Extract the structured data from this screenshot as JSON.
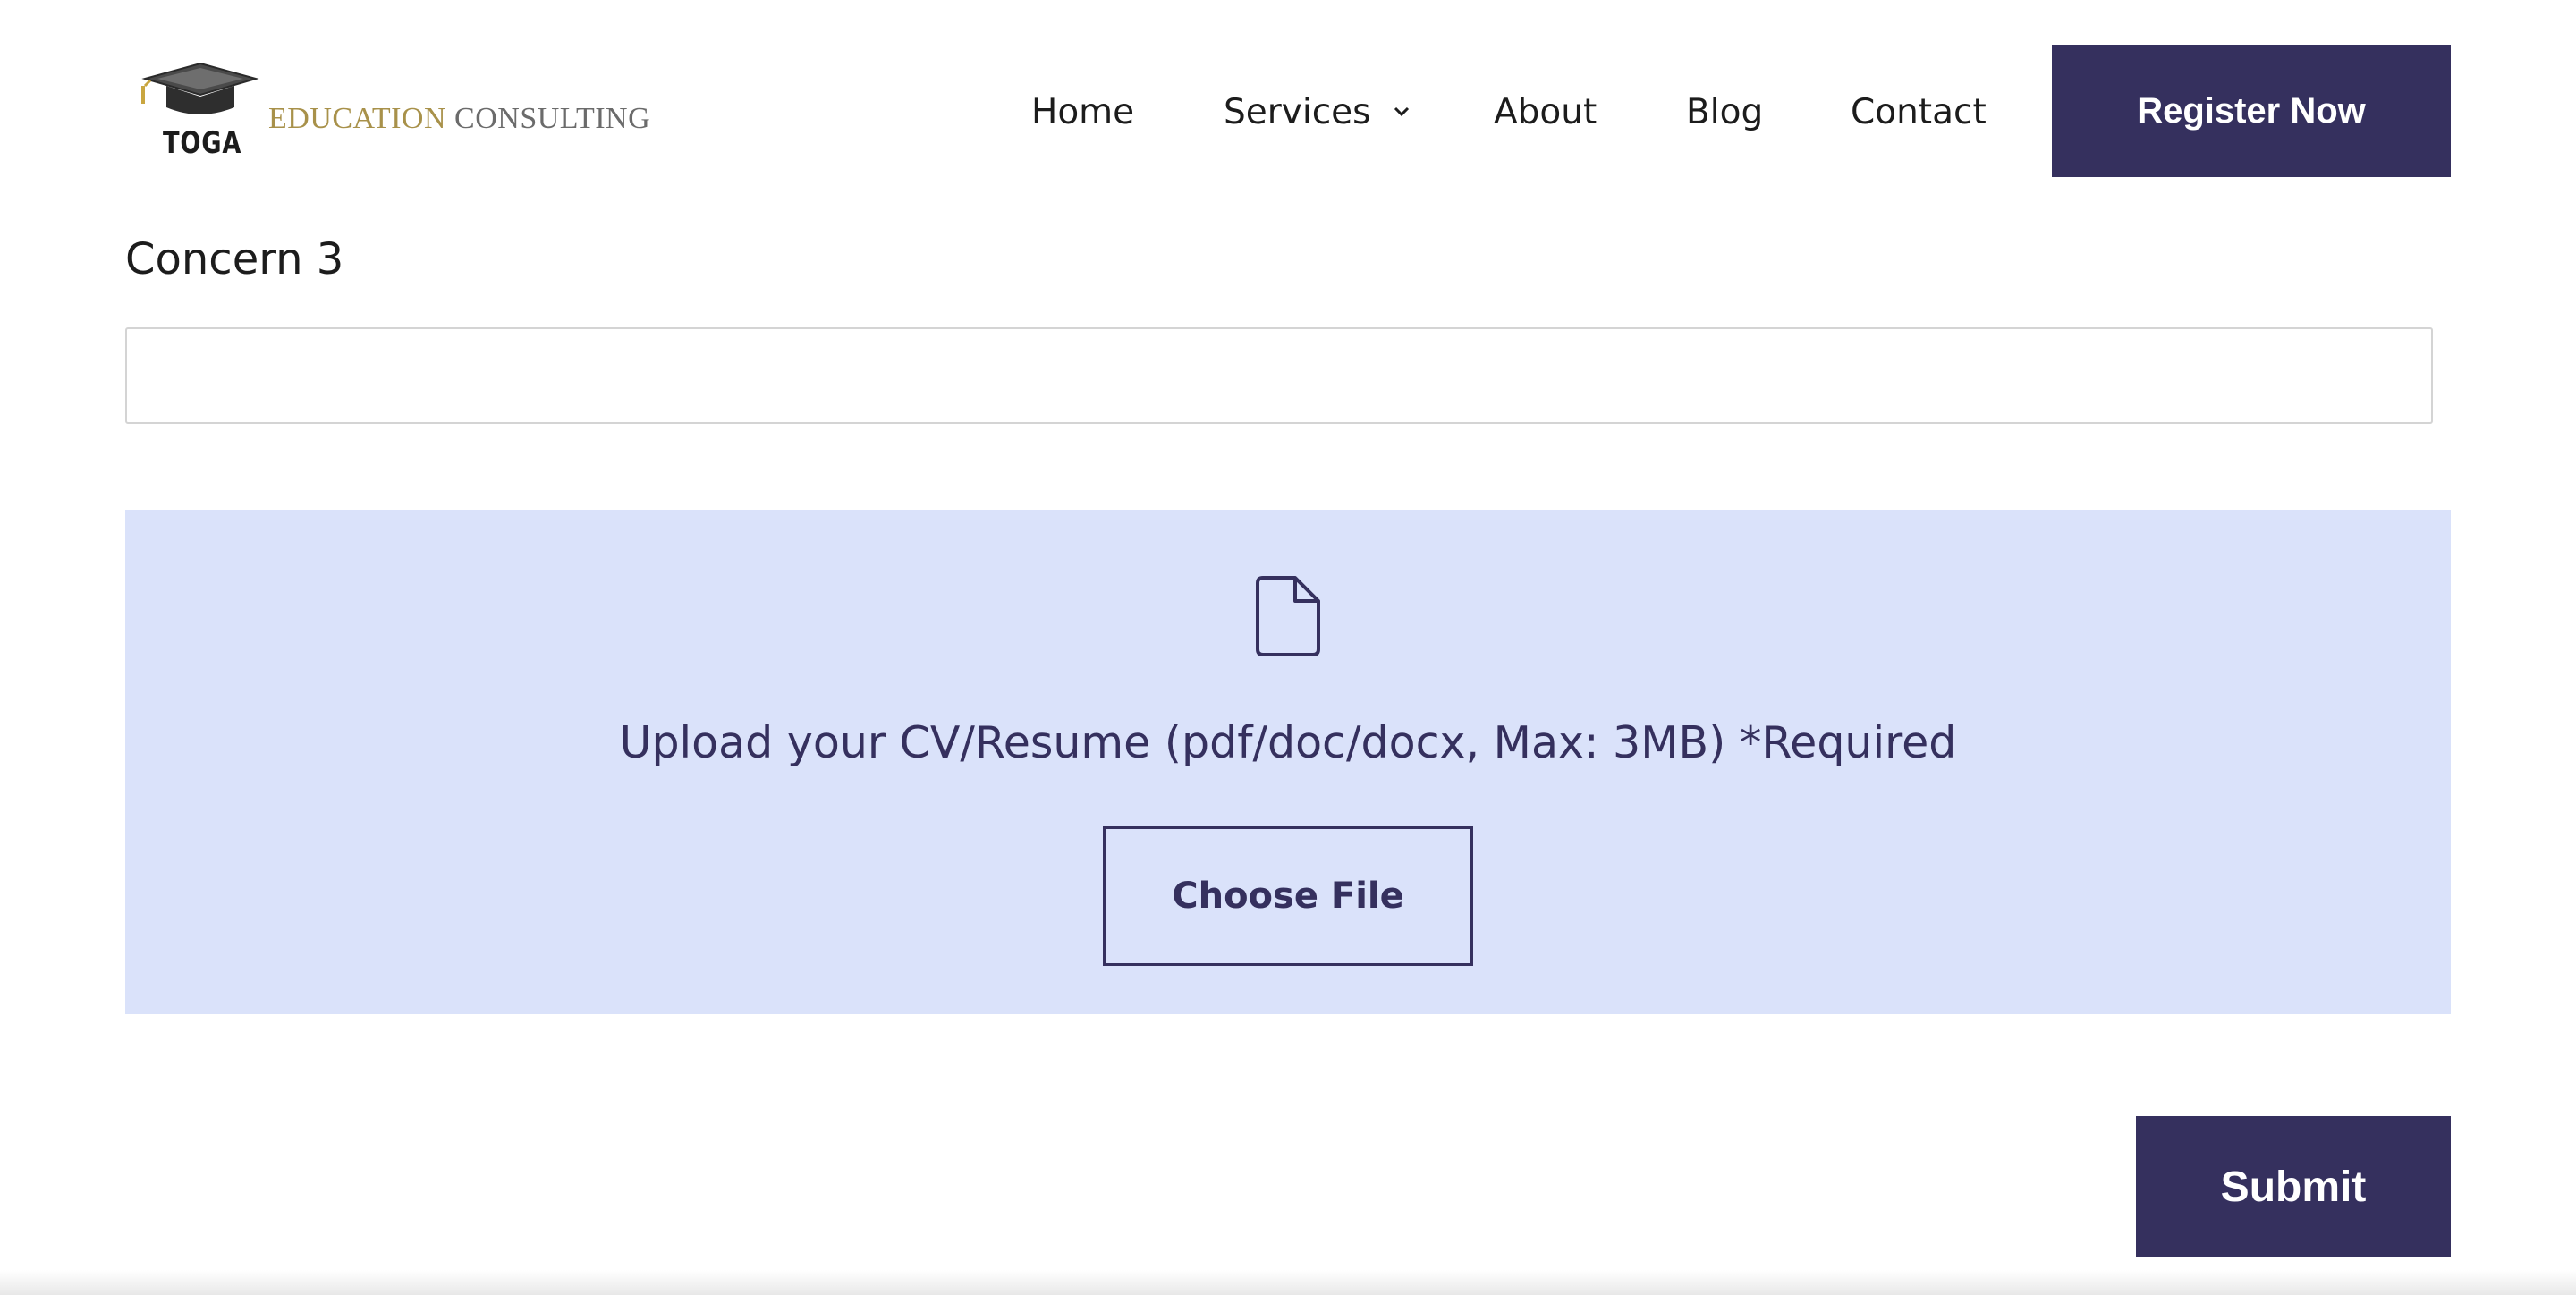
{
  "header": {
    "logo": {
      "mark_text": "TOGA",
      "brand_part1": "EDUCATION",
      "brand_part2": "CONSULTING"
    },
    "nav": [
      {
        "label": "Home"
      },
      {
        "label": "Services",
        "has_dropdown": true
      },
      {
        "label": "About"
      },
      {
        "label": "Blog"
      },
      {
        "label": "Contact"
      }
    ],
    "cta_label": "Register Now"
  },
  "form": {
    "concern3": {
      "label": "Concern 3",
      "value": ""
    },
    "upload": {
      "icon": "file-icon",
      "text": "Upload your CV/Resume (pdf/doc/docx, Max: 3MB) *Required",
      "button_label": "Choose File"
    },
    "submit_label": "Submit"
  },
  "colors": {
    "primary": "#35305e",
    "upload_bg": "#dae2fa",
    "brand_gold": "#a8914a",
    "brand_gray": "#6b6b6b"
  }
}
